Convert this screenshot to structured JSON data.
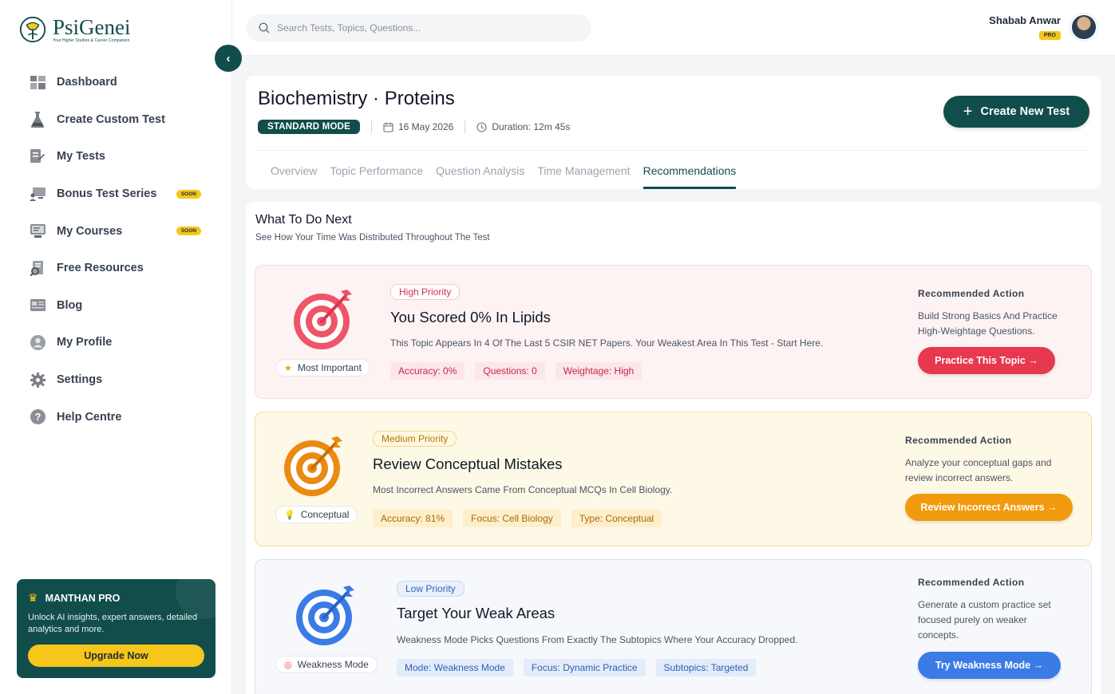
{
  "brand": {
    "name": "PsiGenei",
    "tagline": "Your Higher Studies & Career Companion"
  },
  "sidebar": {
    "items": [
      {
        "label": "Dashboard",
        "icon": "dashboard-icon"
      },
      {
        "label": "Create Custom Test",
        "icon": "flask-icon"
      },
      {
        "label": "My Tests",
        "icon": "test-sheet-icon"
      },
      {
        "label": "Bonus Test Series",
        "icon": "presentation-icon",
        "badge": "SOON"
      },
      {
        "label": "My Courses",
        "icon": "courses-icon",
        "badge": "SOON"
      },
      {
        "label": "Free Resources",
        "icon": "resources-icon"
      },
      {
        "label": "Blog",
        "icon": "blog-icon"
      },
      {
        "label": "My Profile",
        "icon": "profile-icon"
      },
      {
        "label": "Settings",
        "icon": "gear-icon"
      },
      {
        "label": "Help Centre",
        "icon": "help-icon"
      }
    ],
    "pro_card": {
      "title": "MANTHAN PRO",
      "text": "Unlock AI insights, expert answers, detailed analytics and more.",
      "button": "Upgrade Now"
    }
  },
  "topbar": {
    "search_placeholder": "Search Tests, Topics, Questions...",
    "user_name": "Shabab Anwar",
    "user_badge": "PRO"
  },
  "header": {
    "title": "Biochemistry · Proteins",
    "mode": "STANDARD MODE",
    "date": "16 May 2026",
    "duration": "Duration: 12m 45s",
    "create_button": "Create New Test",
    "tabs": [
      "Overview",
      "Topic Performance",
      "Question Analysis",
      "Time Management",
      "Recommendations"
    ],
    "active_tab": "Recommendations"
  },
  "section": {
    "title": "What To Do Next",
    "subtitle": "See How Your Time Was Distributed Throughout The Test"
  },
  "recommendations": [
    {
      "priority": "High Priority",
      "chip": "Most Important",
      "title": "You Scored 0% In Lipids",
      "description": "This Topic Appears In 4 Of The Last 5 CSIR NET Papers. Your Weakest Area In This Test - Start Here.",
      "stats": [
        "Accuracy: 0%",
        "Questions: 0",
        "Weightage: High"
      ],
      "action_title": "Recommended Action",
      "action_text": "Build Strong Basics And Practice High-Weightage Questions.",
      "action_button": "Practice This Topic →",
      "color": "#e8384f"
    },
    {
      "priority": "Medium Priority",
      "chip": "Conceptual",
      "title": "Review Conceptual Mistakes",
      "description": "Most Incorrect Answers Came From Conceptual MCQs In Cell Biology.",
      "stats": [
        "Accuracy: 81%",
        "Focus: Cell Biology",
        "Type: Conceptual"
      ],
      "action_title": "Recommended Action",
      "action_text": "Analyze your conceptual gaps and review incorrect answers.",
      "action_button": "Review Incorrect Answers →",
      "color": "#f29a0d"
    },
    {
      "priority": "Low Priority",
      "chip": "Weakness Mode",
      "title": "Target Your Weak Areas",
      "description": "Weakness Mode Picks Questions From Exactly The Subtopics Where Your Accuracy Dropped.",
      "stats": [
        "Mode: Weakness Mode",
        "Focus: Dynamic Practice",
        "Subtopics: Targeted"
      ],
      "action_title": "Recommended Action",
      "action_text": "Generate a custom practice set focused purely on weaker concepts.",
      "action_button": "Try Weakness Mode →",
      "color": "#3b7be6"
    }
  ]
}
